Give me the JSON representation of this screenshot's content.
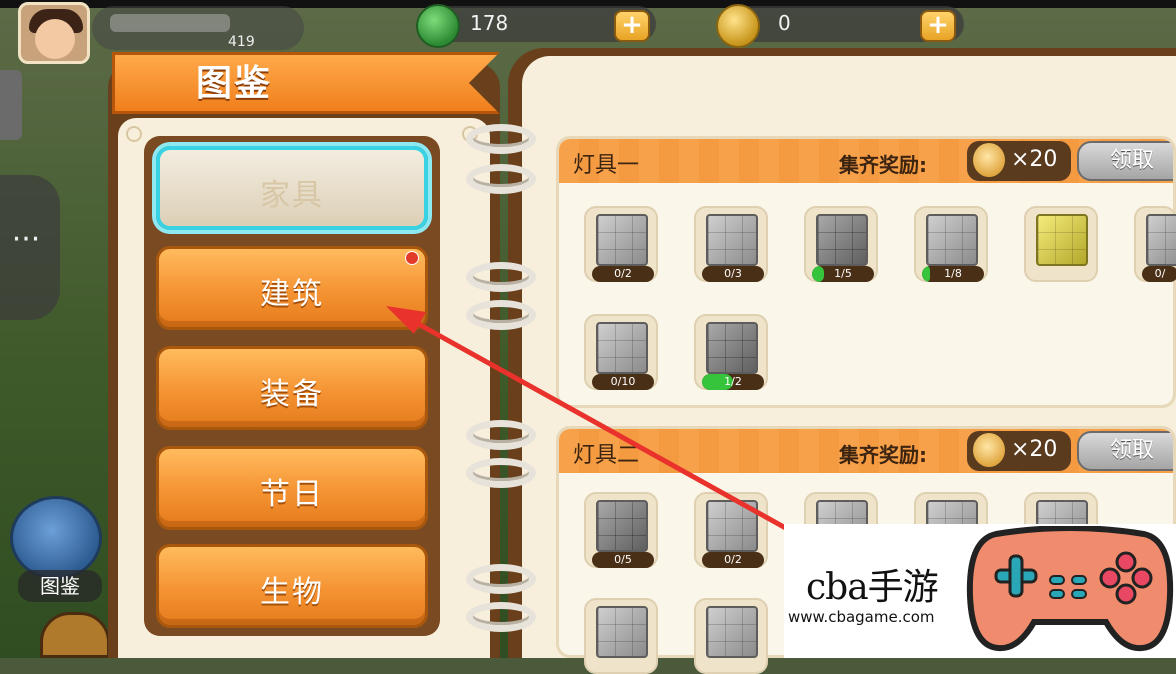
{
  "player": {
    "level": "419"
  },
  "currencies": [
    {
      "icon": "green-gem-icon",
      "value": "178"
    },
    {
      "icon": "gold-coin-icon",
      "value": "0"
    }
  ],
  "sidebar": {
    "handbook_label": "图鉴"
  },
  "book": {
    "title": "图鉴",
    "categories": [
      {
        "label": "家具",
        "selected": true,
        "has_notification": false
      },
      {
        "label": "建筑",
        "selected": false,
        "has_notification": true
      },
      {
        "label": "装备",
        "selected": false,
        "has_notification": false
      },
      {
        "label": "节日",
        "selected": false,
        "has_notification": false
      },
      {
        "label": "生物",
        "selected": false,
        "has_notification": false
      }
    ]
  },
  "sets": [
    {
      "title": "灯具一",
      "reward_label": "集齐奖励:",
      "reward_amount": "×20",
      "claim_label": "领取",
      "items": [
        {
          "progress": "0/2",
          "fill": 0
        },
        {
          "progress": "0/3",
          "fill": 0
        },
        {
          "progress": "1/5",
          "fill": 0.2
        },
        {
          "progress": "1/8",
          "fill": 0.125
        },
        {
          "progress": "",
          "fill": 0
        },
        {
          "progress": "0/",
          "fill": 0
        },
        {
          "progress": "0/10",
          "fill": 0
        },
        {
          "progress": "1/2",
          "fill": 0.5
        }
      ]
    },
    {
      "title": "灯具二",
      "reward_label": "集齐奖励:",
      "reward_amount": "×20",
      "claim_label": "领取",
      "items": [
        {
          "progress": "0/5",
          "fill": 0
        },
        {
          "progress": "0/2",
          "fill": 0
        }
      ]
    }
  ],
  "watermark": {
    "brand": "cba手游",
    "url": "www.cbagame.com"
  },
  "colors": {
    "accent_orange": "#f59333",
    "selected_outline": "#39d2e3",
    "arrow": "#e8322b",
    "progress_green": "#35c43b"
  }
}
